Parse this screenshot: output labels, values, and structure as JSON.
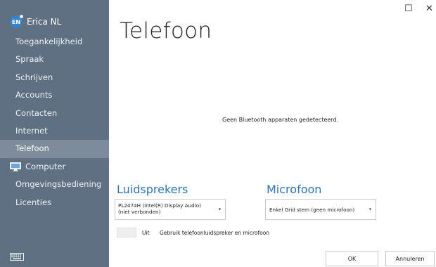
{
  "user": {
    "initials": "EN",
    "name": "Erica NL"
  },
  "sidebar": {
    "items": [
      {
        "label": "Toegankelijkheid"
      },
      {
        "label": "Spraak"
      },
      {
        "label": "Schrijven"
      },
      {
        "label": "Accounts"
      },
      {
        "label": "Contacten"
      },
      {
        "label": "Internet"
      },
      {
        "label": "Telefoon",
        "active": true
      },
      {
        "label": "Computer",
        "icon": "monitor-icon"
      },
      {
        "label": "Omgevingsbediening"
      },
      {
        "label": "Licenties"
      }
    ],
    "footer_icon": "keyboard-icon"
  },
  "window": {
    "maximize": "☐",
    "close": "✕"
  },
  "page": {
    "title": "Telefoon"
  },
  "bluetooth": {
    "message": "Geen Bluetooth apparaten gedetecteerd."
  },
  "speakers": {
    "heading": "Luidsprekers",
    "selected_line1": "PL2474H (Intel(R) Display Audio)",
    "selected_line2": "(niet verbonden)"
  },
  "microphone": {
    "heading": "Microfoon",
    "selected": "Enkel Grid stem (geen microfoon)"
  },
  "phone_audio": {
    "state": "Uit",
    "description": "Gebruik telefoonluidspreker en microfoon"
  },
  "buttons": {
    "ok": "OK",
    "cancel": "Annuleren"
  },
  "colors": {
    "sidebar": "#5f7082",
    "active_item": "#7d8b9a",
    "accent": "#2f75b5"
  }
}
